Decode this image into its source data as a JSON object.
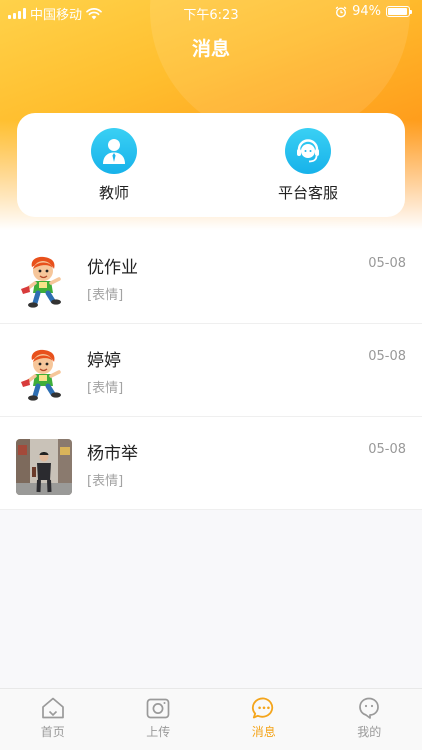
{
  "status_bar": {
    "carrier": "中国移动",
    "time": "下午6:23",
    "battery": "94%",
    "battery_level": 0.94
  },
  "header": {
    "title": "消息"
  },
  "quick_actions": [
    {
      "label": "教师",
      "icon": "teacher-person-icon"
    },
    {
      "label": "平台客服",
      "icon": "customer-service-headset-icon"
    }
  ],
  "conversations": [
    {
      "name": "优作业",
      "preview": "[表情]",
      "date": "05-08",
      "avatar": "cartoon-boy-avatar"
    },
    {
      "name": "婷婷",
      "preview": "[表情]",
      "date": "05-08",
      "avatar": "cartoon-boy-avatar"
    },
    {
      "name": "杨市举",
      "preview": "[表情]",
      "date": "05-08",
      "avatar": "street-photo-avatar"
    }
  ],
  "tab_bar": {
    "active": "消息",
    "tabs": [
      {
        "label": "首页",
        "icon": "home-icon"
      },
      {
        "label": "上传",
        "icon": "camera-icon"
      },
      {
        "label": "消息",
        "icon": "message-bubble-icon"
      },
      {
        "label": "我的",
        "icon": "profile-face-icon"
      }
    ]
  },
  "colors": {
    "header_gradient_start": "#ffd24a",
    "header_gradient_end": "#ff8c12",
    "quick_icon_blue": "#17b2ea",
    "active_tab": "#f4a51c",
    "inactive_tab": "#9a9a9a"
  }
}
